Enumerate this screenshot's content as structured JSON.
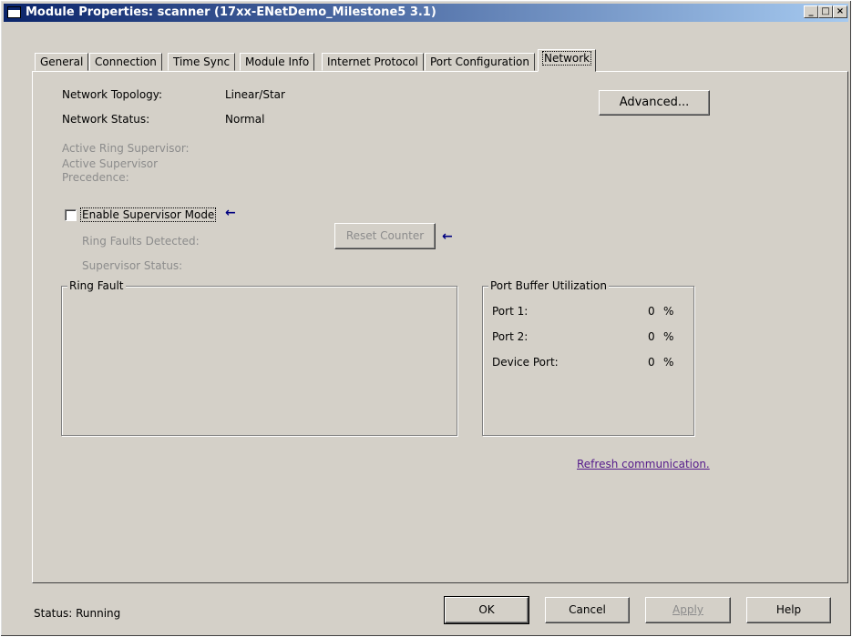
{
  "window": {
    "title": "Module Properties: scanner (17xx-ENetDemo_Milestone5 3.1)",
    "minimize": "_",
    "maximize": "□",
    "close": "×"
  },
  "tabs": [
    {
      "label": "General"
    },
    {
      "label": "Connection"
    },
    {
      "label": "Time Sync"
    },
    {
      "label": "Module Info"
    },
    {
      "label": "Internet Protocol"
    },
    {
      "label": "Port Configuration"
    },
    {
      "label": "Network",
      "active": true
    }
  ],
  "network": {
    "topology_label": "Network Topology:",
    "topology_value": "Linear/Star",
    "status_label": "Network Status:",
    "status_value": "Normal",
    "active_ring_supervisor_label": "Active Ring Supervisor:",
    "active_supervisor_precedence_label": "Active Supervisor Precedence:",
    "advanced_button": "Advanced...",
    "enable_supervisor_mode": "Enable Supervisor Mode",
    "enable_supervisor_checked": false,
    "ring_faults_detected_label": "Ring Faults Detected:",
    "supervisor_status_label": "Supervisor Status:",
    "reset_counter_button": "Reset Counter",
    "arrow": "←"
  },
  "ring_fault": {
    "title": "Ring Fault"
  },
  "port_buffer": {
    "title": "Port Buffer Utilization",
    "rows": [
      {
        "label": "Port 1:",
        "value": "0",
        "unit": "%"
      },
      {
        "label": "Port 2:",
        "value": "0",
        "unit": "%"
      },
      {
        "label": "Device Port:",
        "value": "0",
        "unit": "%"
      }
    ]
  },
  "refresh_link": "Refresh communication.",
  "footer": {
    "status": "Status:  Running",
    "ok": "OK",
    "cancel": "Cancel",
    "apply": "Apply",
    "help": "Help"
  }
}
